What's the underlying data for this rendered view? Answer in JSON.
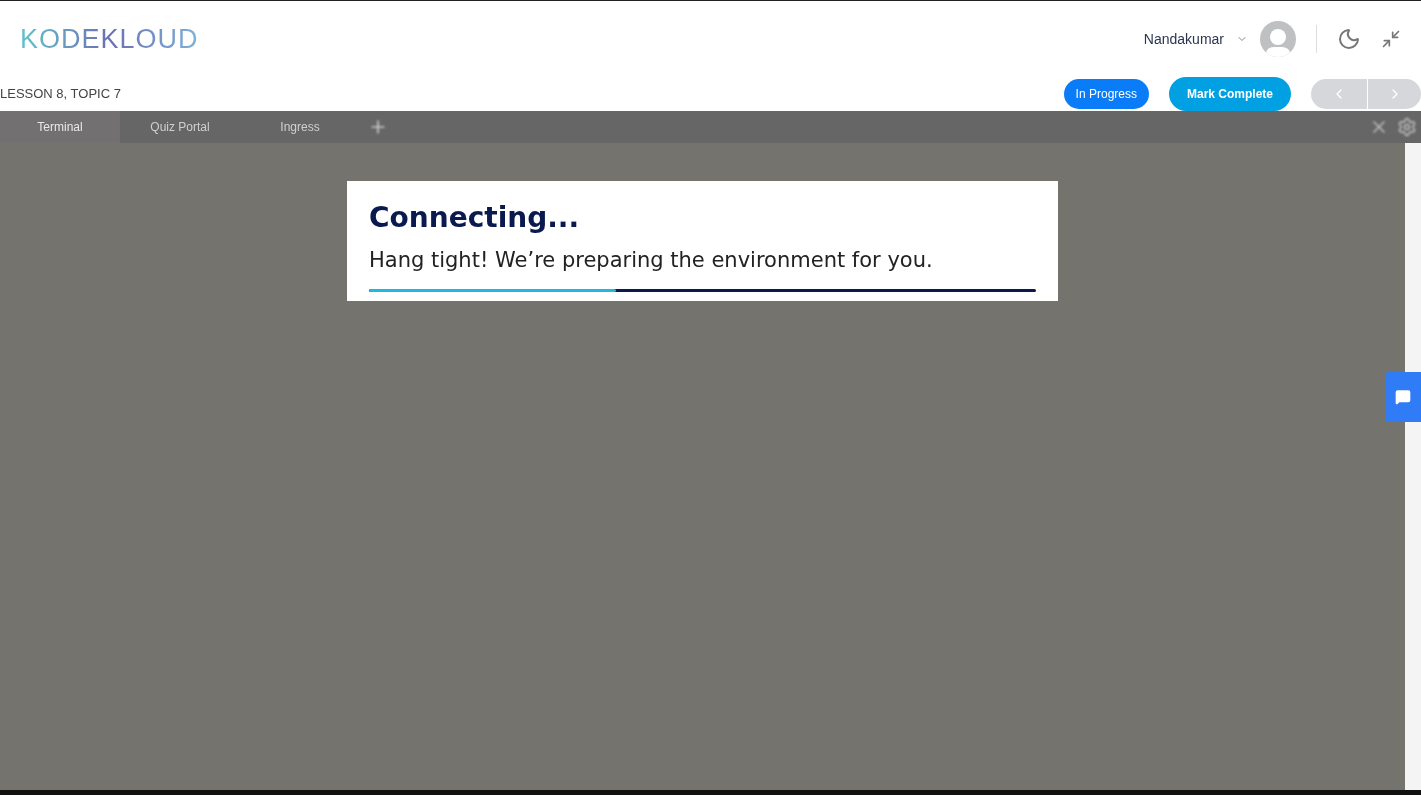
{
  "header": {
    "logo": "KODEKLOUD",
    "user": "Nandakumar"
  },
  "lesson": {
    "label": "LESSON 8, TOPIC 7",
    "status": "In Progress",
    "complete_button": "Mark Complete"
  },
  "terminal": {
    "tabs": [
      {
        "label": "Terminal",
        "selected": true
      },
      {
        "label": "Quiz Portal",
        "selected": false
      },
      {
        "label": "Ingress",
        "selected": false
      }
    ],
    "dialog": {
      "title": "Connecting...",
      "message": "Hang tight! We’re preparing the environment for you.",
      "level": 0.37
    }
  }
}
